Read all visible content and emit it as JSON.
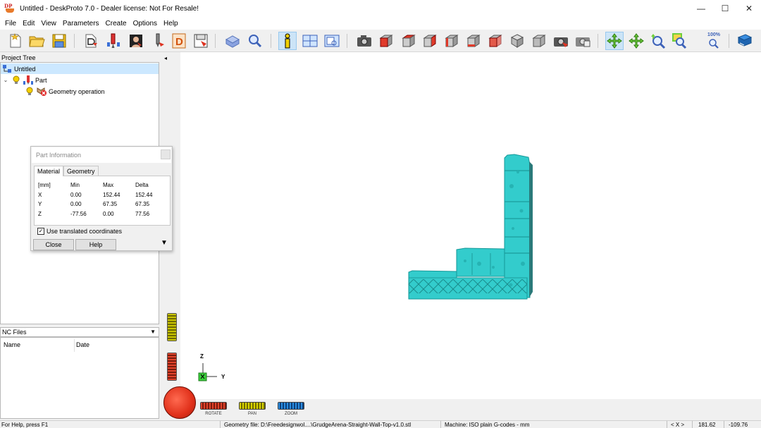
{
  "window": {
    "title": "Untitled - DeskProto 7.0 - Dealer license: Not For Resale!",
    "logo_text": "DP",
    "minimize_glyph": "—",
    "maximize_glyph": "☐",
    "close_glyph": "✕"
  },
  "menu": [
    "File",
    "Edit",
    "View",
    "Parameters",
    "Create",
    "Options",
    "Help"
  ],
  "toolbar": {
    "icons": [
      "new-project-icon",
      "open-project-icon",
      "save-project-icon",
      "load-geometry-icon",
      "part-icon",
      "bitmap-icon",
      "tool-icon",
      "drawing-icon",
      "save-toolpath-icon",
      "simulation-icon",
      "zoom-part-icon",
      "info-icon",
      "layout-icon",
      "view-screen-icon",
      "camera-icon",
      "view-front-icon",
      "view-top-icon",
      "view-right-icon",
      "view-left-icon",
      "view-bottom-icon",
      "view-back-icon",
      "view-iso-icon",
      "view-iso2-icon",
      "snapshot-icon",
      "print-icon",
      "rotate-tool-icon",
      "pan-tool-icon",
      "zoom-tool-icon",
      "zoom-window-icon",
      "zoom-100-icon",
      "help-book-icon"
    ],
    "zoom_label": "100%",
    "active": "info-icon"
  },
  "project_tree": {
    "header": "Project Tree",
    "root": "Untitled",
    "part": "Part",
    "operation": "Geometry operation",
    "expand_glyph": "⌄"
  },
  "nc_files": {
    "header": "NC Files",
    "dropdown_glyph": "▼",
    "columns": [
      "Name",
      "Date"
    ]
  },
  "part_info": {
    "title": "Part Information",
    "tabs": [
      "Material",
      "Geometry"
    ],
    "active_tab": "Material",
    "header": [
      "[mm]",
      "Min",
      "Max",
      "Delta"
    ],
    "rows": [
      [
        "X",
        "0.00",
        "152.44",
        "152.44"
      ],
      [
        "Y",
        "0.00",
        "67.35",
        "67.35"
      ],
      [
        "Z",
        "-77.56",
        "0.00",
        "77.56"
      ]
    ],
    "checkbox_label": "Use translated coordinates",
    "checkbox_checked": true,
    "check_glyph": "✓",
    "close_label": "Close",
    "help_label": "Help",
    "more_glyph": "▼"
  },
  "viewport": {
    "collapse_glyph": "◂",
    "axis_z": "Z",
    "axis_y": "Y",
    "rotate_label": "ROTATE",
    "pan_label": "PAN",
    "zoom_label": "ZOOM",
    "model_color": "#33cccc",
    "background": "#ffffff"
  },
  "status": {
    "help": "For Help, press F1",
    "geometry": "Geometry file: D:\\Freedesignwol....\\GrudgeArena-Straight-Wall-Top-v1.0.stl",
    "machine": "Machine: ISO plain G-codes - mm",
    "axis_sel": "< X >",
    "coord_x": "181.62",
    "coord_y": "-109.76"
  }
}
